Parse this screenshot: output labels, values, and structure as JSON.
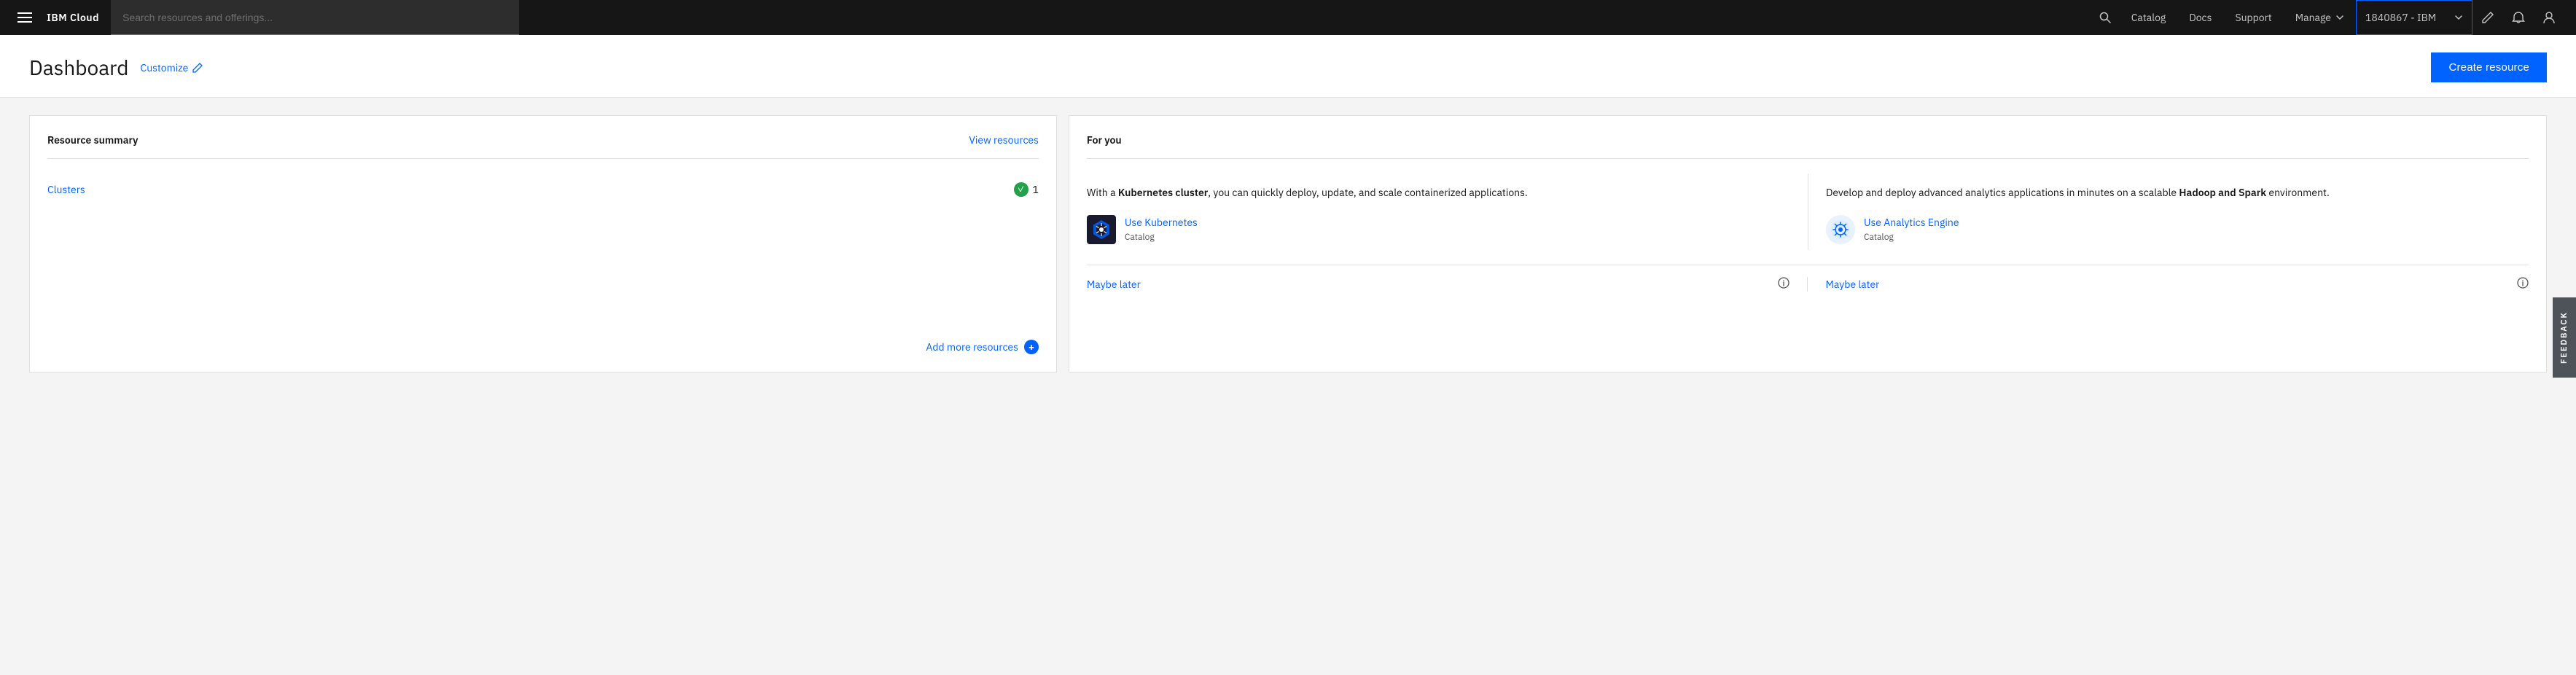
{
  "topnav": {
    "brand": "IBM Cloud",
    "search_placeholder": "Search resources and offerings...",
    "links": [
      "Catalog",
      "Docs",
      "Support"
    ],
    "manage_label": "Manage",
    "account_label": "1840867 - IBM",
    "edit_icon": "✏",
    "notification_icon": "🔔",
    "user_icon": "👤"
  },
  "header": {
    "title": "Dashboard",
    "customize_label": "Customize",
    "create_resource_label": "Create resource"
  },
  "resource_summary": {
    "title": "Resource summary",
    "view_resources_label": "View resources",
    "clusters_label": "Clusters",
    "cluster_count": "1",
    "add_more_label": "Add more resources"
  },
  "for_you": {
    "title": "For you",
    "item1": {
      "description_pre": "With a ",
      "description_bold": "Kubernetes cluster",
      "description_post": ", you can quickly deploy, update, and scale containerized applications.",
      "service_name": "Use Kubernetes",
      "catalog_label": "Catalog"
    },
    "item2": {
      "description_pre": "Develop and deploy advanced analytics applications in minutes on a scalable ",
      "description_bold": "Hadoop and Spark",
      "description_post": " environment.",
      "service_name": "Use Analytics Engine",
      "catalog_label": "Catalog"
    },
    "maybe_later_label": "Maybe later",
    "maybe_later_label2": "Maybe later"
  },
  "feedback": {
    "label": "FEEDBACK"
  }
}
